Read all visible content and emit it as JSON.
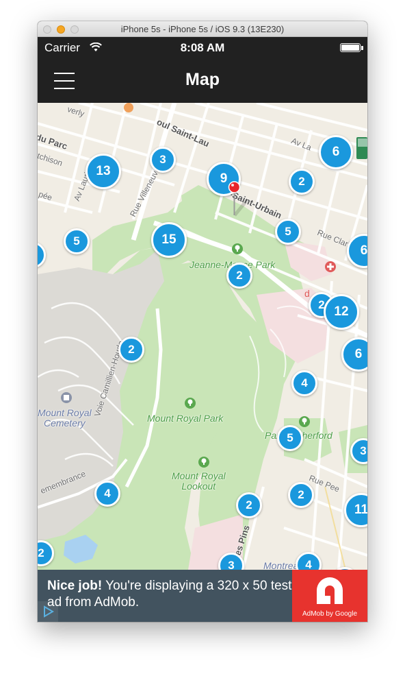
{
  "window": {
    "title": "iPhone 5s - iPhone 5s / iOS 9.3 (13E230)"
  },
  "status_bar": {
    "carrier": "Carrier",
    "time": "8:08 AM",
    "wifi_icon": "wifi-icon",
    "battery_icon": "battery-icon"
  },
  "nav": {
    "title": "Map",
    "menu_icon": "hamburger-menu-icon"
  },
  "map": {
    "labels": {
      "park_jeanne": "Jeanne-Mance Park",
      "mount_royal_park": "Mount Royal Park",
      "mount_royal_lookout": "Mount Royal\nLookout",
      "parc_rutherford": "Parc Rutherford",
      "mount_royal_cemetery": "Mount Royal\nCemetery",
      "voie_camillien": "Voie Camillien-Houde",
      "rue_saint_urbain": "Rue-Saint-Urbain",
      "rue_villeneuve": "Rue Villeneuve O",
      "rue_clark": "Rue Clark",
      "av_laurier": "Av Lauri",
      "du_parc": "du Parc",
      "atchison": "tchison",
      "everly": "verly",
      "epee": "pée",
      "av_lal": "Av La",
      "saint_laurent": "oul Saint-Lau",
      "remembrance": "emembrance",
      "des_pins": "des Pins",
      "rue_peel": "Rue Pee",
      "montreal_mus": "Montreal Mus",
      "hotel_fragment": "d"
    },
    "clusters": [
      "13",
      "3",
      "9",
      "6",
      "2",
      "5",
      "15",
      "5",
      "6",
      "2",
      "2",
      "12",
      "2",
      "6",
      "4",
      "5",
      "3",
      "4",
      "2",
      "11",
      "2",
      "3",
      "4",
      "3",
      "2",
      "4"
    ]
  },
  "ad": {
    "headline": "Nice job!",
    "body": " You're displaying a 320 x 50 test ad from AdMob.",
    "brand": "AdMob by Google",
    "brand_color": "#e7332e",
    "background": "#42535f"
  }
}
